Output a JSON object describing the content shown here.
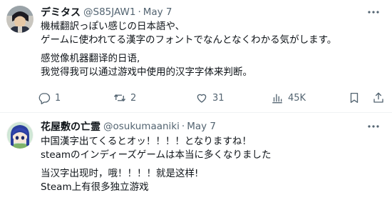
{
  "tweets": [
    {
      "author": {
        "display_name": "デミタス",
        "handle": "@S85JAW1",
        "separator": "·",
        "date": "May 7"
      },
      "lines": [
        "機械翻訳っぽい感じの日本語や、",
        "ゲームに使われてる漢字のフォントでなんとなくわかる気がします。",
        "感觉像机器翻译的日语,",
        "我觉得我可以通过游戏中使用的汉字字体来判断。"
      ],
      "actions": {
        "replies": "1",
        "retweets": "2",
        "likes": "31",
        "views": "45K"
      }
    },
    {
      "author": {
        "display_name": "花屋敷の亡霊",
        "handle": "@osukumaaniki",
        "separator": "·",
        "date": "May 7"
      },
      "lines": [
        "中国漢字出てくるとオッ！！！！となりますね！",
        "steamのインディーズゲームは本当に多くなりました",
        "当汉字出现时，哦！！！！就是这样!",
        "Steam上有很多独立游戏"
      ]
    }
  ],
  "colors": {
    "text": "#0f1419",
    "secondary": "#536471",
    "divider": "#eff3f4"
  },
  "icons": {
    "more": "more-horizontal-icon",
    "reply": "reply-icon",
    "retweet": "retweet-icon",
    "like": "heart-icon",
    "views": "views-icon",
    "bookmark": "bookmark-icon",
    "share": "share-icon"
  }
}
